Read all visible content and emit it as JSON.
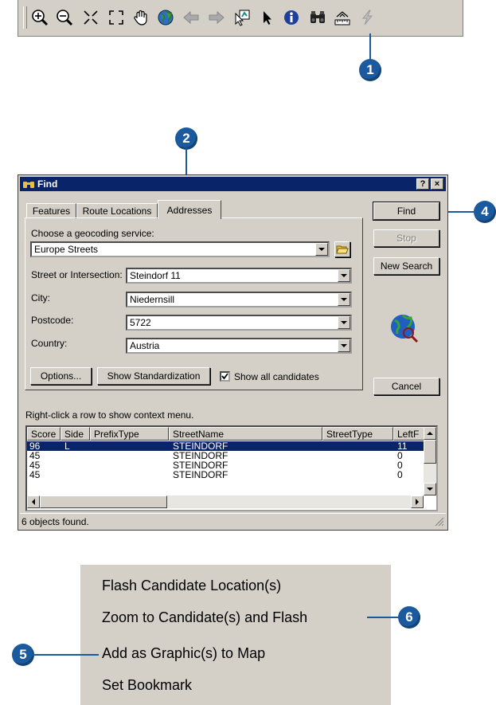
{
  "toolbar": {
    "buttons": [
      {
        "icon": "zoom-in-icon"
      },
      {
        "icon": "zoom-out-icon"
      },
      {
        "icon": "fixed-zoom-in-icon"
      },
      {
        "icon": "fixed-zoom-out-icon"
      },
      {
        "icon": "pan-hand-icon"
      },
      {
        "icon": "full-extent-globe-icon"
      },
      {
        "icon": "back-arrow-icon"
      },
      {
        "icon": "forward-arrow-icon"
      },
      {
        "icon": "select-features-icon"
      },
      {
        "icon": "select-elements-icon"
      },
      {
        "icon": "identify-icon"
      },
      {
        "icon": "find-binoculars-icon"
      },
      {
        "icon": "measure-icon"
      },
      {
        "icon": "hyperlink-icon"
      }
    ]
  },
  "callouts": {
    "c1": "1",
    "c2": "2",
    "c4": "4",
    "c5": "5",
    "c6": "6"
  },
  "dialog": {
    "title": "Find",
    "help_btn": "?",
    "close_btn": "×",
    "tabs": [
      "Features",
      "Route Locations",
      "Addresses"
    ],
    "active_tab": "Addresses",
    "service_label": "Choose a geocoding service:",
    "service_value": "Europe Streets",
    "fields": [
      {
        "label": "Street or Intersection:",
        "value": "Steindorf 11"
      },
      {
        "label": "City:",
        "value": "Niedernsill"
      },
      {
        "label": "Postcode:",
        "value": "5722"
      },
      {
        "label": "Country:",
        "value": "Austria"
      }
    ],
    "options_btn": "Options...",
    "standardization_btn": "Show Standardization",
    "show_all_label": "Show all candidates",
    "show_all_checked": true,
    "find_btn": "Find",
    "stop_btn": "Stop",
    "new_search_btn": "New Search",
    "cancel_btn": "Cancel",
    "context_hint": "Right-click a row to show context menu.",
    "columns": [
      "Score",
      "Side",
      "PrefixType",
      "StreetName",
      "StreetType",
      "LeftF"
    ],
    "rows": [
      [
        "96",
        "L",
        "",
        "STEINDORF",
        "",
        "11"
      ],
      [
        "45",
        "",
        "",
        "STEINDORF",
        "",
        "0"
      ],
      [
        "45",
        "",
        "",
        "STEINDORF",
        "",
        "0"
      ],
      [
        "45",
        "",
        "",
        "STEINDORF",
        "",
        "0"
      ]
    ],
    "status": "6 objects found."
  },
  "context_menu": {
    "items": [
      "Flash Candidate Location(s)",
      "Zoom to Candidate(s) and Flash",
      "Add as Graphic(s) to Map",
      "Set Bookmark"
    ]
  }
}
